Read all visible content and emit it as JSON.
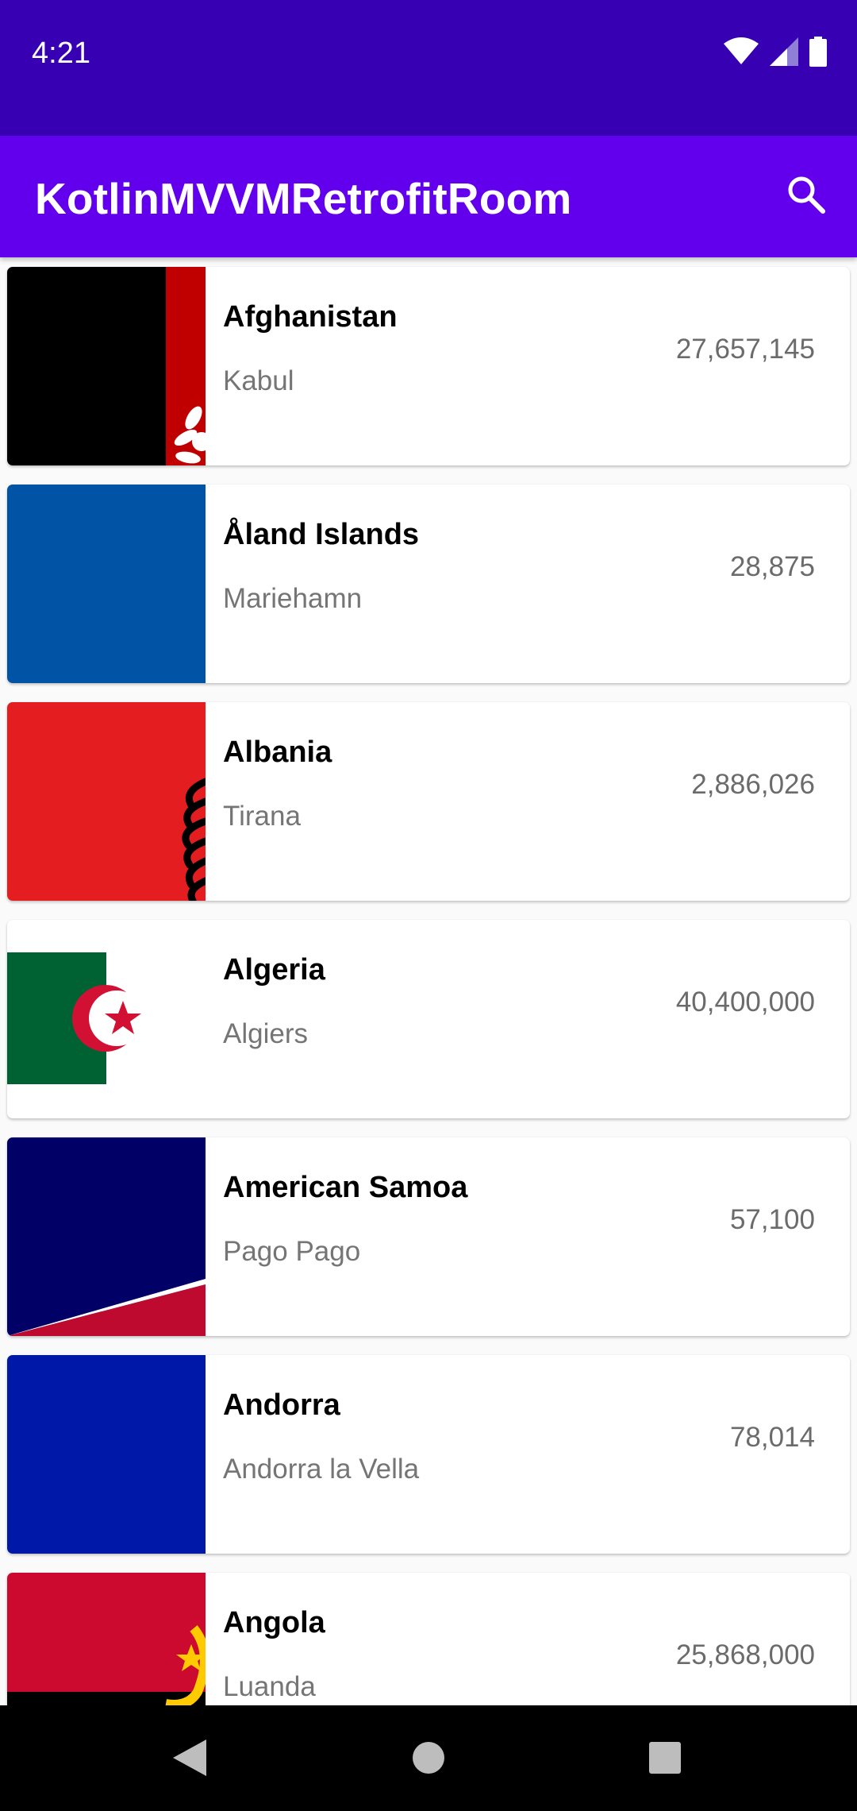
{
  "status_bar": {
    "time": "4:21",
    "icons": [
      "wifi-icon",
      "cellular-signal-icon",
      "battery-icon"
    ]
  },
  "app_bar": {
    "title": "KotlinMVVMRetrofitRoom",
    "action_icon": "search-icon"
  },
  "countries": [
    {
      "name": "Afghanistan",
      "capital": "Kabul",
      "population": "27,657,145",
      "flag": "afghanistan"
    },
    {
      "name": "Åland Islands",
      "capital": "Mariehamn",
      "population": "28,875",
      "flag": "aland"
    },
    {
      "name": "Albania",
      "capital": "Tirana",
      "population": "2,886,026",
      "flag": "albania"
    },
    {
      "name": "Algeria",
      "capital": "Algiers",
      "population": "40,400,000",
      "flag": "algeria"
    },
    {
      "name": "American Samoa",
      "capital": "Pago Pago",
      "population": "57,100",
      "flag": "american-samoa"
    },
    {
      "name": "Andorra",
      "capital": "Andorra la Vella",
      "population": "78,014",
      "flag": "andorra"
    },
    {
      "name": "Angola",
      "capital": "Luanda",
      "population": "25,868,000",
      "flag": "angola"
    }
  ],
  "nav_bar": {
    "buttons": [
      "back-icon",
      "home-icon",
      "recents-icon"
    ]
  },
  "colors": {
    "status_bar": "#3700b3",
    "app_bar": "#6200ee"
  }
}
